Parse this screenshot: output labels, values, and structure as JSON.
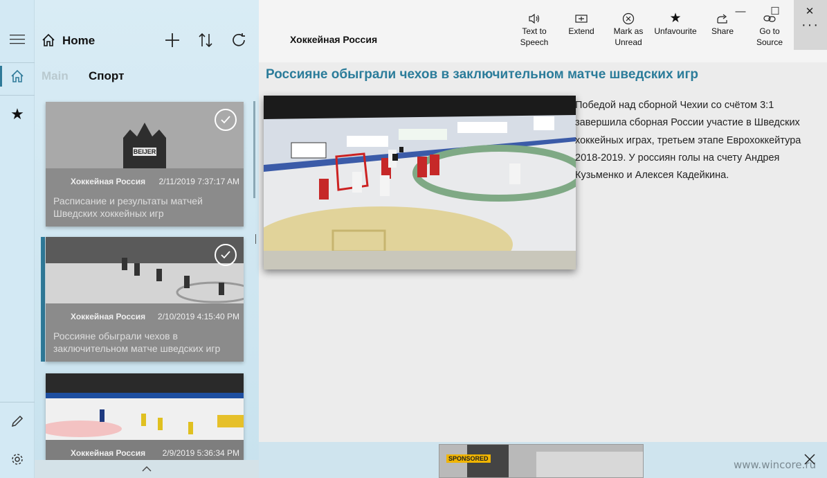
{
  "window": {
    "controls": [
      "—",
      "☐",
      "✕"
    ]
  },
  "rail": {
    "items": [
      {
        "name": "menu",
        "icon": "hamburger-icon"
      },
      {
        "name": "home",
        "icon": "home-icon"
      },
      {
        "name": "favourites",
        "icon": "star-icon"
      },
      {
        "name": "edit",
        "icon": "pencil-icon"
      },
      {
        "name": "settings",
        "icon": "gear-icon"
      }
    ]
  },
  "feed": {
    "home_label": "Home",
    "tabs": [
      {
        "label": "Main",
        "active": false
      },
      {
        "label": "Спорт",
        "active": true
      }
    ],
    "cards": [
      {
        "source": "Хоккейная Россия",
        "date": "2/11/2019 7:37:17 AM",
        "title": "Расписание и результаты матчей Шведских хоккейных игр",
        "read": true,
        "image_text": "BEIJER"
      },
      {
        "source": "Хоккейная Россия",
        "date": "2/10/2019 4:15:40 PM",
        "title": "Россияне обыграли чехов в заключительном матче шведских игр",
        "read": true,
        "selected": true
      },
      {
        "source": "Хоккейная Россия",
        "date": "2/9/2019 5:36:34 PM",
        "title": "",
        "read": false
      }
    ]
  },
  "reader": {
    "feed_name": "Хоккейная Россия",
    "commands": [
      {
        "label": "Text to Speech",
        "line1": "Text to",
        "line2": "Speech",
        "icon": "speaker-icon"
      },
      {
        "label": "Extend",
        "line1": "Extend",
        "line2": "",
        "icon": "extend-icon"
      },
      {
        "label": "Mark as Unread",
        "line1": "Mark as",
        "line2": "Unread",
        "icon": "circle-x-icon"
      },
      {
        "label": "Unfavourite",
        "line1": "Unfavourite",
        "line2": "",
        "icon": "star-filled-icon"
      },
      {
        "label": "Share",
        "line1": "Share",
        "line2": "",
        "icon": "share-icon"
      },
      {
        "label": "Go to Source",
        "line1": "Go to",
        "line2": "Source",
        "icon": "link-icon"
      }
    ],
    "more": "···",
    "article": {
      "title": "Россияне обыграли чехов в заключительном матче шведских игр",
      "body": "Победой над сборной Чехии со счётом 3:1 завершила сборная России участие в Шведских хоккейных играх, третьем этапе Еврохоккейтура 2018-2019. У россиян голы на счету Андрея Кузьменко и Алексея Кадейкина."
    }
  },
  "ad": {
    "tag": "SPONSORED",
    "watermark": "www.wincore.ru"
  },
  "colors": {
    "accent": "#2f7a99",
    "title": "#2b7c9a",
    "rail_bg": "#d3e9f4",
    "card_bg": "#8b8b8b"
  }
}
